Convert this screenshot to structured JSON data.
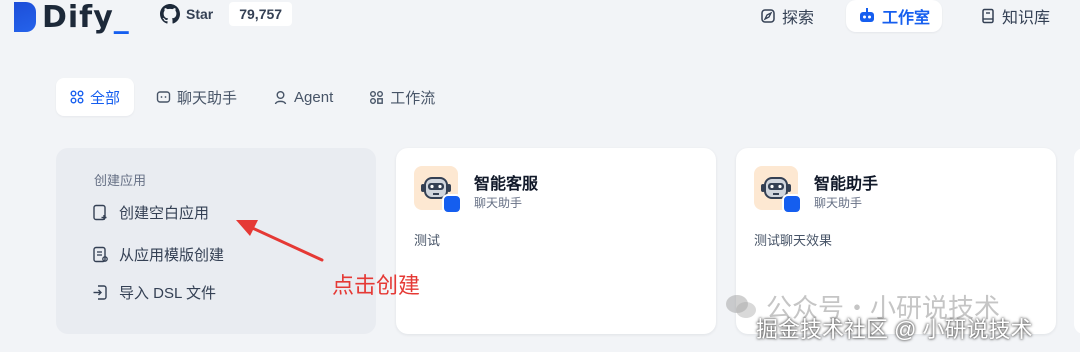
{
  "header": {
    "brand": "Dify",
    "github": {
      "label": "Star",
      "count": "79,757"
    },
    "nav": [
      {
        "label": "探索",
        "icon": "compass-icon"
      },
      {
        "label": "工作室",
        "icon": "robot-icon"
      },
      {
        "label": "知识库",
        "icon": "book-icon"
      }
    ]
  },
  "tabs": [
    {
      "label": "全部",
      "icon": "grid-icon",
      "active": true
    },
    {
      "label": "聊天助手",
      "icon": "chat-icon"
    },
    {
      "label": "Agent",
      "icon": "agent-icon"
    },
    {
      "label": "工作流",
      "icon": "workflow-icon"
    }
  ],
  "create": {
    "title": "创建应用",
    "items": [
      "创建空白应用",
      "从应用模版创建",
      "导入 DSL 文件"
    ]
  },
  "apps": [
    {
      "name": "智能客服",
      "type": "聊天助手",
      "desc": "测试"
    },
    {
      "name": "智能助手",
      "type": "聊天助手",
      "desc": "测试聊天效果"
    }
  ],
  "annotation": "点击创建",
  "watermark": {
    "line1": "公众号・小研说技术",
    "line2": "掘金技术社区 @ 小研说技术"
  },
  "colors": {
    "accent": "#155eef",
    "annotation": "#e53935",
    "background": "#f2f4f7"
  }
}
